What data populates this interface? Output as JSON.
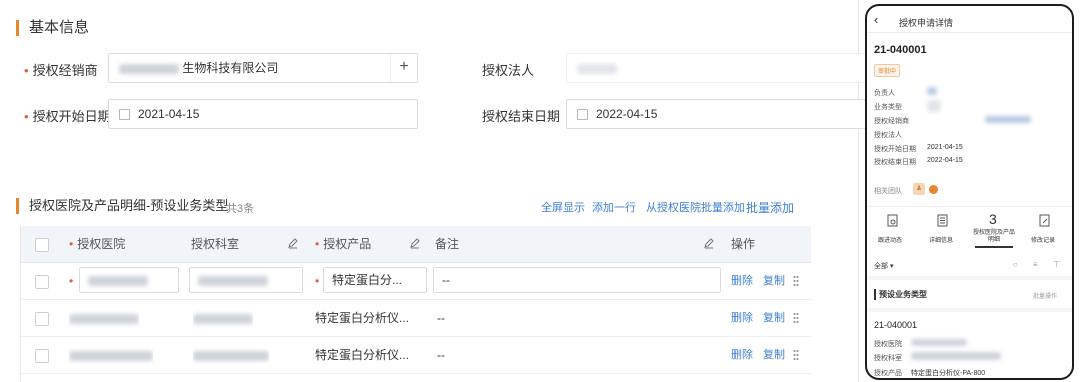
{
  "basic_info": {
    "title": "基本信息",
    "distributor_label": "授权经销商",
    "distributor_value": "生物科技有限公司",
    "legal_label": "授权法人",
    "start_label": "授权开始日期",
    "start_value": "2021-04-15",
    "end_label": "授权结束日期",
    "end_value": "2022-04-15",
    "plus_icon": "+"
  },
  "detail_section": {
    "title": "授权医院及产品明细-预设业务类型",
    "count": "共3条",
    "actions": [
      "全屏显示",
      "添加一行",
      "从授权医院批量添加",
      "批量添加"
    ]
  },
  "table": {
    "headers": {
      "hospital": "授权医院",
      "department": "授权科室",
      "product": "授权产品",
      "remark": "备注",
      "ops": "操作"
    },
    "rows": [
      {
        "product": "特定蛋白分...",
        "remark": "--",
        "delete": "删除",
        "copy": "复制"
      },
      {
        "product": "特定蛋白分析仪...",
        "remark": "--",
        "delete": "删除",
        "copy": "复制"
      },
      {
        "product": "特定蛋白分析仪...",
        "remark": "--",
        "delete": "删除",
        "copy": "复制"
      }
    ]
  },
  "mobile": {
    "nav_title": "授权申请详情",
    "record_no": "21-040001",
    "status_badge": "审批中",
    "fields": [
      {
        "label": "负责人",
        "value": ""
      },
      {
        "label": "业务类型",
        "value": ""
      },
      {
        "label": "授权经销商",
        "value": ""
      },
      {
        "label": "授权法人",
        "value": ""
      },
      {
        "label": "授权开始日期",
        "value": "2021-04-15"
      },
      {
        "label": "授权结束日期",
        "value": "2022-04-15"
      }
    ],
    "team_label": "相关团队",
    "tabs": [
      {
        "label": "跟进动态",
        "icon": "doc-search-icon"
      },
      {
        "label": "详细信息",
        "icon": "list-doc-icon"
      },
      {
        "label": "授权医院及产品明细",
        "count": "3"
      },
      {
        "label": "修改记录",
        "icon": "edit-doc-icon"
      }
    ],
    "filter_label": "全部",
    "sub_section_title": "预设业务类型",
    "sub_section_action": "批量操作",
    "card": {
      "record_no": "21-040001",
      "hospital_label": "授权医院",
      "department_label": "授权科室",
      "product_label": "授权产品",
      "product_value": "特定蛋白分析仪-PA-800"
    },
    "colors": {
      "accent": "#e6862e",
      "link": "#3f7fd6"
    }
  }
}
